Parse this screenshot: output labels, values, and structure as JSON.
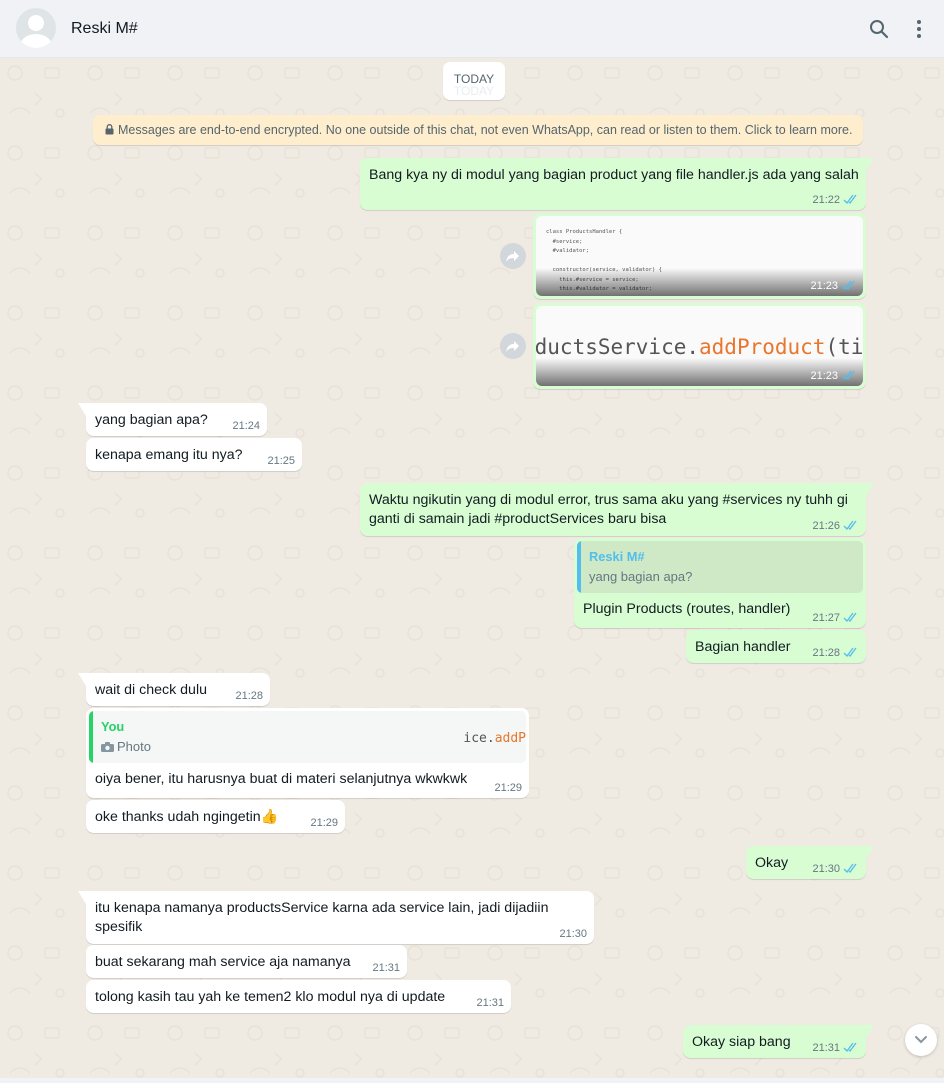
{
  "header": {
    "contact_name": "Reski M#",
    "icons": [
      "avatar-placeholder",
      "search-icon",
      "menu-icon"
    ]
  },
  "chat": {
    "day_label": "TODAY",
    "day_ghost": "TODAY",
    "encryption_notice": "Messages are end-to-end encrypted. No one outside of this chat, not even WhatsApp, can read or listen to them. Click to learn more.",
    "colors": {
      "outgoing": "#d9fdd3",
      "incoming": "#ffffff",
      "tick_read": "#53bdeb",
      "background": "#efeae2",
      "notice": "#ffeecd"
    },
    "messages": [
      {
        "text": "Bang kya ny di modul yang bagian product yang file handler.js ada yang salah",
        "time": "21:22"
      },
      {
        "time": "21:23",
        "image_code": "class ProductsHandler {\n  #service;\n  #validator;\n\n  constructor(service, validator) {\n    this.#service = service;\n    this.#validator = validator;"
      },
      {
        "time": "21:23",
        "image_code_pre": "oductsService.",
        "image_code_method": "addProduct",
        "image_code_post": "(tit"
      },
      {
        "text": "yang bagian apa?",
        "time": "21:24"
      },
      {
        "text": "kenapa emang itu nya?",
        "time": "21:25"
      },
      {
        "text": "Waktu ngikutin yang di modul error, trus sama aku yang #services ny tuhh gi ganti di samain jadi #productServices baru bisa",
        "time": "21:26"
      },
      {
        "quote_name": "Reski M#",
        "quote_text": "yang bagian apa?",
        "text": "Plugin Products (routes, handler)",
        "time": "21:27"
      },
      {
        "text": "Bagian handler",
        "time": "21:28"
      },
      {
        "text": "wait di check dulu",
        "time": "21:28"
      },
      {
        "quote_name": "You",
        "quote_text": "Photo",
        "quote_thumb_pre": "ice.",
        "quote_thumb_method": "addP",
        "text": "oiya bener, itu harusnya buat di materi selanjutnya wkwkwk",
        "time": "21:29"
      },
      {
        "text": "oke thanks udah ngingetin👍",
        "time": "21:29"
      },
      {
        "text": "Okay",
        "time": "21:30"
      },
      {
        "text": "itu kenapa namanya productsService karna ada service lain, jadi dijadiin spesifik",
        "time": "21:30"
      },
      {
        "text": "buat sekarang mah service aja namanya",
        "time": "21:31"
      },
      {
        "text": "tolong kasih tau yah ke temen2 klo modul nya di update",
        "time": "21:31"
      },
      {
        "text": "Okay siap bang",
        "time": "21:31"
      }
    ]
  }
}
